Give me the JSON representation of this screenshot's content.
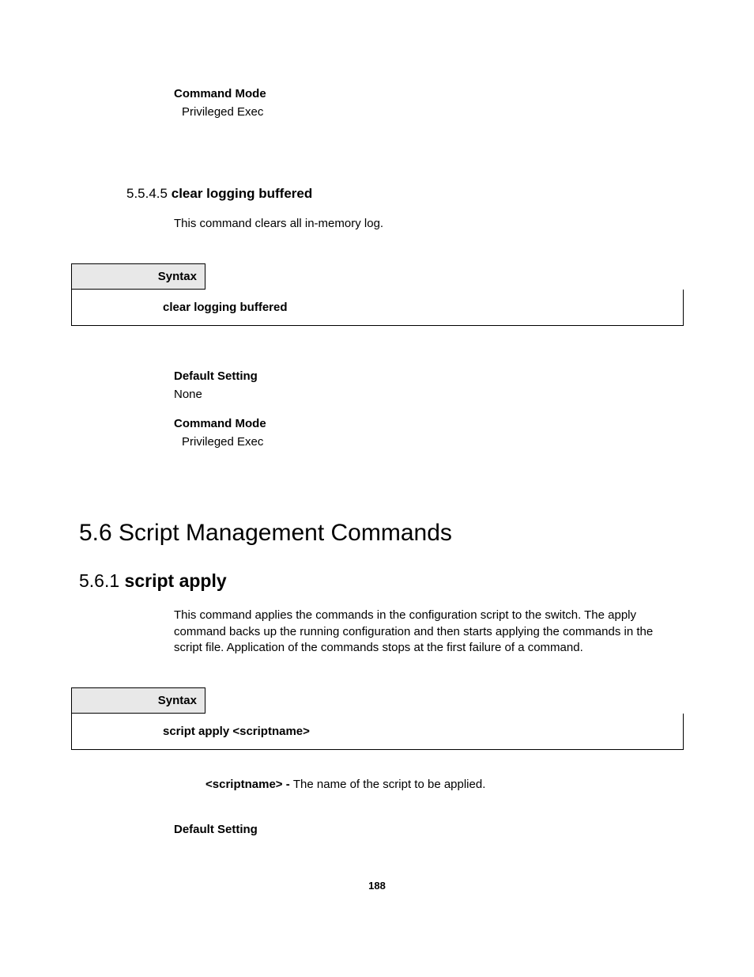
{
  "top": {
    "cmd_mode_label": "Command Mode",
    "cmd_mode_value": "Privileged Exec"
  },
  "sec5545": {
    "number": "5.5.4.5",
    "title": "clear logging buffered",
    "desc": "This command clears all in-memory log.",
    "syntax_label": "Syntax",
    "syntax_body": "clear logging buffered",
    "default_label": "Default Setting",
    "default_value": "None",
    "cmd_mode_label": "Command Mode",
    "cmd_mode_value": "Privileged Exec"
  },
  "sec56": {
    "heading": "5.6 Script Management Commands"
  },
  "sec561": {
    "number": "5.6.1",
    "title": "script apply",
    "desc": "This command applies the commands in the configuration script to the switch. The apply command backs up the running configuration and then starts applying the commands in the script file. Application of the commands stops at the first failure of a command.",
    "syntax_label": "Syntax",
    "syntax_body": "script apply <scriptname>",
    "param_name": "<scriptname> - ",
    "param_desc": "The name of the script to be applied.",
    "default_label": "Default Setting"
  },
  "page_number": "188"
}
